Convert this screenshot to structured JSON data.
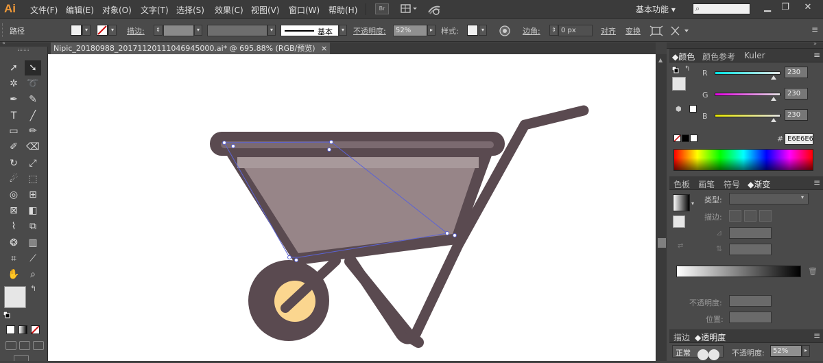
{
  "app": {
    "logo": "Ai"
  },
  "menu": [
    "文件(F)",
    "编辑(E)",
    "对象(O)",
    "文字(T)",
    "选择(S)",
    "效果(C)",
    "视图(V)",
    "窗口(W)",
    "帮助(H)"
  ],
  "menu_br": "Br",
  "workspace": "基本功能",
  "control": {
    "object_type": "路径",
    "stroke_label": "描边",
    "profile_label": "基本",
    "opacity_label": "不透明度",
    "opacity_value": "52%",
    "style_label": "样式",
    "corner_label": "边角",
    "corner_value": "0 px",
    "align_label": "对齐",
    "transform_label": "变换"
  },
  "document": {
    "tab": "Nipic_20180988_20171120111046945000.ai* @ 695.88% (RGB/预览)",
    "close": "×"
  },
  "color_panel": {
    "tabs": [
      "颜色",
      "颜色参考",
      "Kuler"
    ],
    "channels": [
      {
        "label": "R",
        "value": "230"
      },
      {
        "label": "G",
        "value": "230"
      },
      {
        "label": "B",
        "value": "230"
      }
    ],
    "hex_label": "#",
    "hex": "E6E6E6"
  },
  "gradient_panel": {
    "tabs": [
      "色板",
      "画笔",
      "符号",
      "渐变"
    ],
    "type_label": "类型",
    "stroke_label": "描边",
    "opacity_label": "不透明度",
    "position_label": "位置"
  },
  "transparency_panel": {
    "tabs": [
      "描边",
      "透明度"
    ],
    "mode": "正常",
    "opacity_label": "不透明度",
    "opacity_value": "52%"
  },
  "colors": {
    "brand": "#f29a38",
    "body": "#5a4a50",
    "tray": "#978588",
    "hub": "#fbd68f",
    "path": "#5b63d6",
    "fill": "#e6e6e6"
  }
}
